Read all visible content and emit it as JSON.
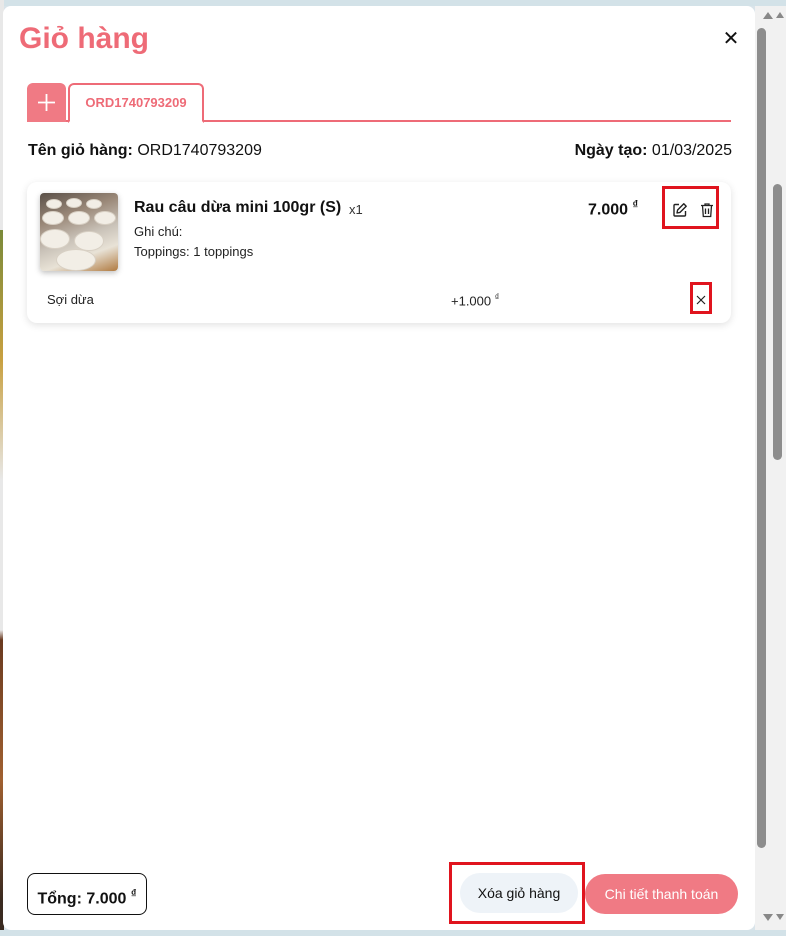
{
  "modal": {
    "title": "Giỏ hàng",
    "close_icon": "close-icon"
  },
  "tabs": {
    "add_icon": "plus-icon",
    "items": [
      {
        "label": "ORD1740793209",
        "active": true
      }
    ]
  },
  "cart_info": {
    "name_label": "Tên giỏ hàng:",
    "name_value": "ORD1740793209",
    "date_label": "Ngày tạo:",
    "date_value": "01/03/2025"
  },
  "item": {
    "name": "Rau câu dừa mini 100gr (S)",
    "quantity": "x1",
    "price": "7.000",
    "currency": "₫",
    "note": "Ghi chú:",
    "toppings_summary": "Toppings: 1 toppings",
    "actions": {
      "edit_icon": "edit-icon",
      "delete_icon": "trash-icon"
    },
    "toppings": [
      {
        "name": "Sợi dừa",
        "price": "+1.000",
        "currency": "₫",
        "remove_icon": "close-icon"
      }
    ]
  },
  "footer": {
    "total_label": "Tổng:",
    "total_value": "7.000",
    "currency": "₫",
    "clear_button": "Xóa giỏ hàng",
    "checkout_button": "Chi tiết thanh toán"
  },
  "colors": {
    "accent": "#ee6b77",
    "highlight_border": "#e0141e",
    "clear_button_bg": "#eef3f8"
  }
}
